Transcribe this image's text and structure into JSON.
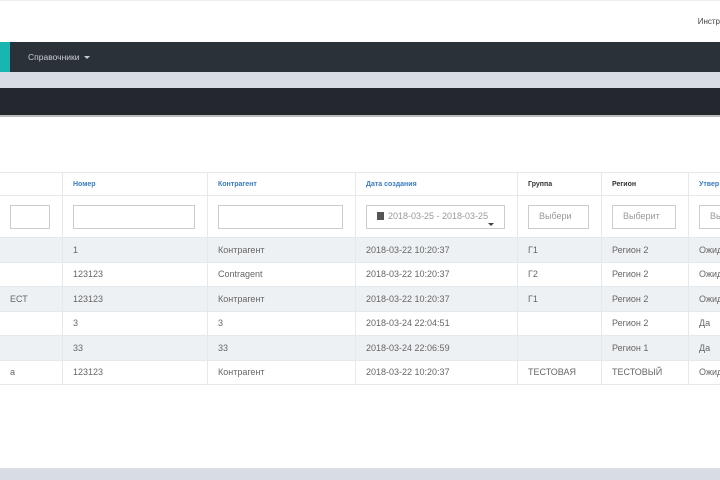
{
  "topbar": {
    "right_text": "Инстр"
  },
  "nav": {
    "menu_label": "Справочники",
    "accent_color": "#19b5b0"
  },
  "table": {
    "headers": [
      "",
      "Номер",
      "Контрагент",
      "Дата создания",
      "Группа",
      "Регион",
      "Утвер"
    ],
    "filters": {
      "date_range": "2018-03-25 - 2018-03-25",
      "group_placeholder": "Выбери",
      "region_placeholder": "Выберит",
      "approved_placeholder": "Вы"
    },
    "rows": [
      [
        "",
        "1",
        "Контрагент",
        "2018-03-22 10:20:37",
        "Г1",
        "Регион 2",
        "Ожид"
      ],
      [
        "",
        "123123",
        "Contragent",
        "2018-03-22 10:20:37",
        "Г2",
        "Регион 2",
        "Ожид"
      ],
      [
        "ЕСТ",
        "123123",
        "Контрагент",
        "2018-03-22 10:20:37",
        "Г1",
        "Регион 2",
        "Ожид"
      ],
      [
        "",
        "3",
        "3",
        "2018-03-24 22:04:51",
        "",
        "Регион 2",
        "Да"
      ],
      [
        "",
        "33",
        "33",
        "2018-03-24 22:06:59",
        "",
        "Регион 1",
        "Да"
      ],
      [
        "а",
        "123123",
        "Контрагент",
        "2018-03-22 10:20:37",
        "ТЕСТОВАЯ",
        "ТЕСТОВЫЙ",
        "Ожид"
      ]
    ]
  }
}
